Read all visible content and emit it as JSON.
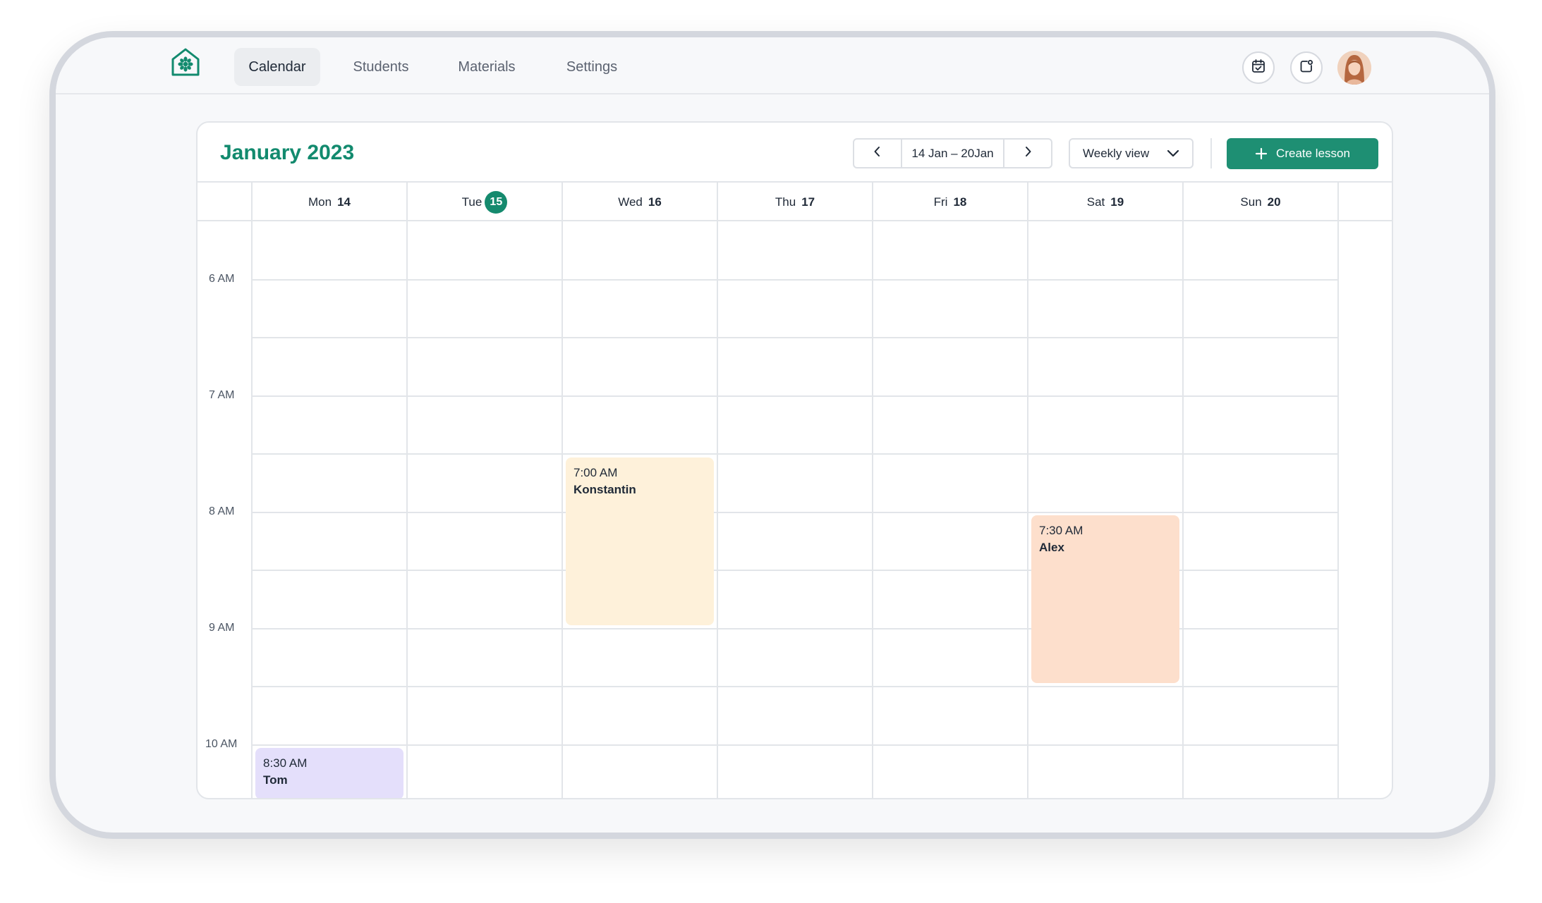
{
  "nav": {
    "logo_icon": "flower-house-icon",
    "items": [
      {
        "label": "Calendar",
        "active": true
      },
      {
        "label": "Students",
        "active": false
      },
      {
        "label": "Materials",
        "active": false
      },
      {
        "label": "Settings",
        "active": false
      }
    ],
    "actions": [
      "calendar-check-icon",
      "notification-icon"
    ],
    "avatar": "user-avatar"
  },
  "calendar": {
    "month_title": "January 2023",
    "date_range": "14 Jan – 20Jan",
    "view_label": "Weekly view",
    "create_label": "Create lesson",
    "days": [
      {
        "name": "Mon",
        "num": "14",
        "today": false
      },
      {
        "name": "Tue",
        "num": "15",
        "today": true
      },
      {
        "name": "Wed",
        "num": "16",
        "today": false
      },
      {
        "name": "Thu",
        "num": "17",
        "today": false
      },
      {
        "name": "Fri",
        "num": "18",
        "today": false
      },
      {
        "name": "Sat",
        "num": "19",
        "today": false
      },
      {
        "name": "Sun",
        "num": "20",
        "today": false
      }
    ],
    "time_labels": [
      "6 AM",
      "7 AM",
      "8 AM",
      "9 AM",
      "10 AM"
    ],
    "events": [
      {
        "time": "7:00 AM",
        "name": "Konstantin",
        "day": "Wed",
        "color": "#fef1da"
      },
      {
        "time": "7:30 AM",
        "name": "Alex",
        "day": "Sat",
        "color": "#fddfcc"
      },
      {
        "time": "8:30 AM",
        "name": "Tom",
        "day": "Mon",
        "color": "#e4dffb"
      }
    ],
    "colors": {
      "accent": "#128a6e",
      "button": "#1e8f73"
    }
  }
}
